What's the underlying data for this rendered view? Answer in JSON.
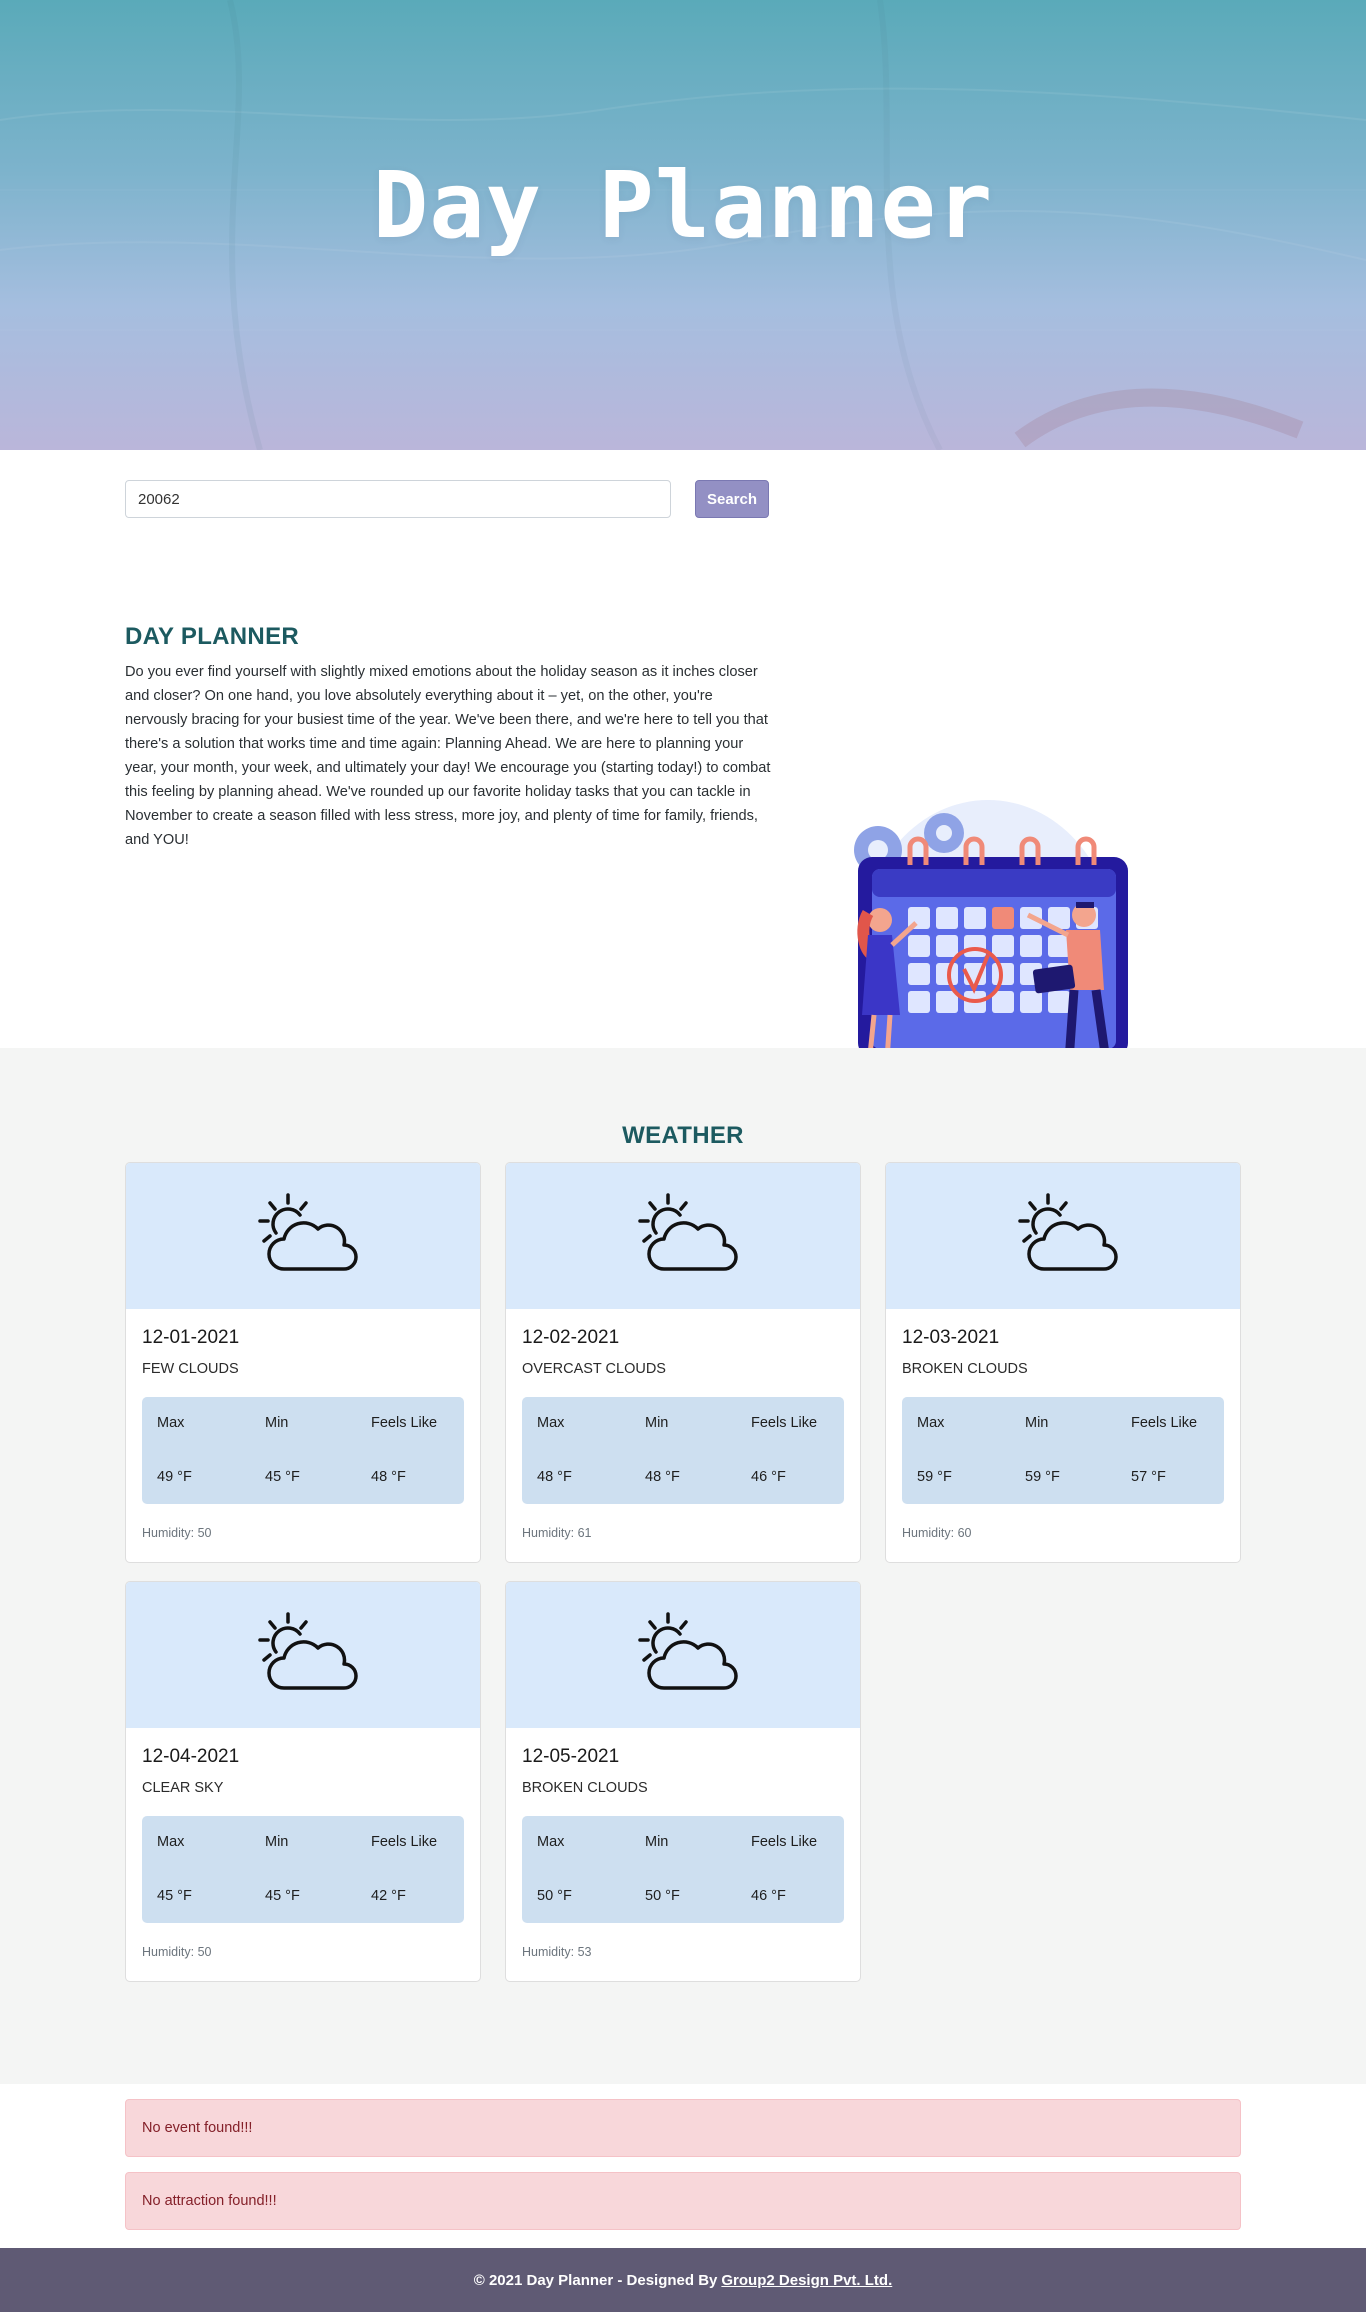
{
  "hero": {
    "title": "Day Planner"
  },
  "search": {
    "value": "20062",
    "button_label": "Search"
  },
  "about": {
    "heading": "DAY PLANNER",
    "body": "Do you ever find yourself with slightly mixed emotions about the holiday season as it inches closer and closer? On one hand, you love absolutely everything about it – yet, on the other, you're nervously bracing for your busiest time of the year. We've been there, and we're here to tell you that there's a solution that works time and time again: Planning Ahead. We are here to planning your year, your month, your week, and ultimately your day! We encourage you (starting today!) to combat this feeling by planning ahead. We've rounded up our favorite holiday tasks that you can tackle in November to create a season filled with less stress, more joy, and plenty of time for family, friends, and YOU!"
  },
  "weather": {
    "heading": "WEATHER",
    "labels": {
      "max": "Max",
      "min": "Min",
      "feels": "Feels Like"
    },
    "icon": "partly-cloudy-icon",
    "days": [
      {
        "date": "12-01-2021",
        "description": "FEW CLOUDS",
        "max": "49 °F",
        "min": "45 °F",
        "feels": "48 °F",
        "humidity": "Humidity: 50"
      },
      {
        "date": "12-02-2021",
        "description": "OVERCAST CLOUDS",
        "max": "48 °F",
        "min": "48 °F",
        "feels": "46 °F",
        "humidity": "Humidity: 61"
      },
      {
        "date": "12-03-2021",
        "description": "BROKEN CLOUDS",
        "max": "59 °F",
        "min": "59 °F",
        "feels": "57 °F",
        "humidity": "Humidity: 60"
      },
      {
        "date": "12-04-2021",
        "description": "CLEAR SKY",
        "max": "45 °F",
        "min": "45 °F",
        "feels": "42 °F",
        "humidity": "Humidity: 50"
      },
      {
        "date": "12-05-2021",
        "description": "BROKEN CLOUDS",
        "max": "50 °F",
        "min": "50 °F",
        "feels": "46 °F",
        "humidity": "Humidity: 53"
      }
    ]
  },
  "alerts": {
    "events": "No event found!!!",
    "attractions": "No attraction found!!!"
  },
  "footer": {
    "text": "© 2021 Day Planner - Designed By",
    "link": "Group2 Design Pvt. Ltd."
  },
  "colors": {
    "accent_heading": "#1c5a60",
    "search_button": "#9390c4",
    "footer_bg": "#5f5a74",
    "alert_bg": "#f8d7da",
    "card_top": "#d9e9fb",
    "temp_box": "#cddff0"
  }
}
